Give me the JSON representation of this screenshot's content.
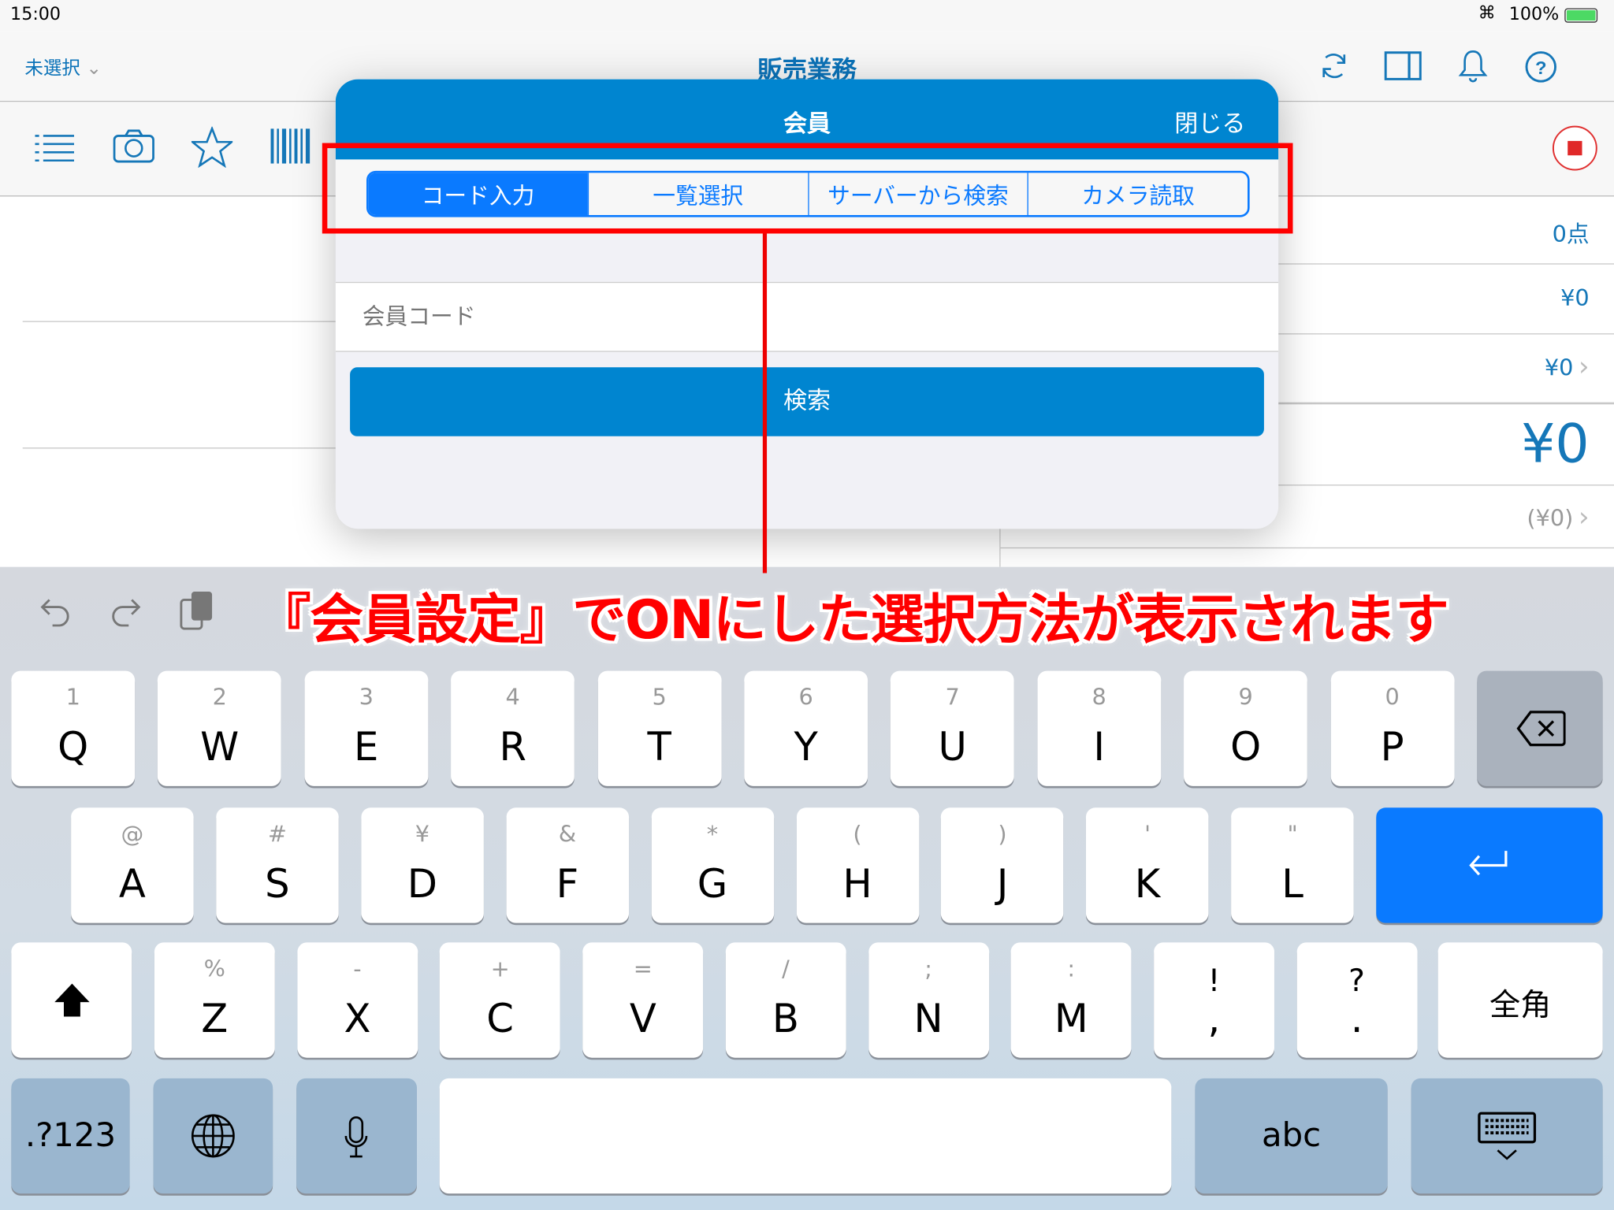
{
  "status_bar": {
    "time": "15:00",
    "battery": "100%"
  },
  "nav": {
    "store_select": "未選択",
    "title": "販売業務"
  },
  "right_panel": {
    "count": "0点",
    "subtotal": "¥0",
    "discount": "¥0",
    "total": "¥0",
    "tax": "(¥0)"
  },
  "modal": {
    "title": "会員",
    "close_label": "閉じる",
    "segments": [
      "コード入力",
      "一覧選択",
      "サーバーから検索",
      "カメラ読取"
    ],
    "selected_segment": "コード入力",
    "member_code_placeholder": "会員コード",
    "member_code_value": "",
    "search_label": "検索"
  },
  "annotation": "『会員設定』でONにした選択方法が表示されます",
  "colors": {
    "accent": "#0085d0",
    "ios_blue": "#0a7aff",
    "annotation_red": "#ff0000"
  },
  "keyboard": {
    "row1": [
      [
        "1",
        "Q"
      ],
      [
        "2",
        "W"
      ],
      [
        "3",
        "E"
      ],
      [
        "4",
        "R"
      ],
      [
        "5",
        "T"
      ],
      [
        "6",
        "Y"
      ],
      [
        "7",
        "U"
      ],
      [
        "8",
        "I"
      ],
      [
        "9",
        "O"
      ],
      [
        "0",
        "P"
      ]
    ],
    "row2": [
      [
        "@",
        "A"
      ],
      [
        "#",
        "S"
      ],
      [
        "¥",
        "D"
      ],
      [
        "&",
        "F"
      ],
      [
        "*",
        "G"
      ],
      [
        "(",
        "H"
      ],
      [
        ")",
        "J"
      ],
      [
        "'",
        "K"
      ],
      [
        "\"",
        "L"
      ]
    ],
    "row3": [
      [
        "%",
        "Z"
      ],
      [
        "-",
        "X"
      ],
      [
        "+",
        "C"
      ],
      [
        "=",
        "V"
      ],
      [
        "/",
        "B"
      ],
      [
        ";",
        "N"
      ],
      [
        ":",
        "M"
      ],
      [
        "!",
        ","
      ],
      [
        "?",
        "."
      ]
    ],
    "fullwidth_label": "全角",
    "numbers_label": ".?123",
    "abc_label": "abc"
  }
}
